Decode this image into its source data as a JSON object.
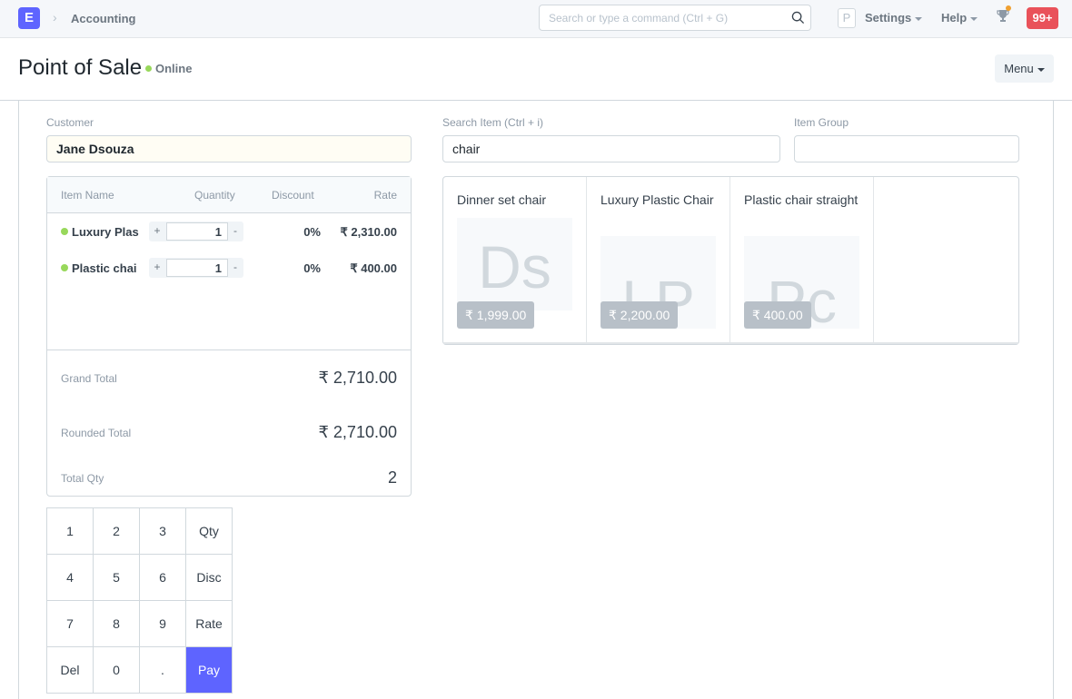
{
  "navbar": {
    "logo_letter": "E",
    "breadcrumb": "Accounting",
    "search_placeholder": "Search or type a command (Ctrl + G)",
    "search_value": "",
    "avatar_letter": "P",
    "settings_label": "Settings",
    "help_label": "Help",
    "notification_count": "99+"
  },
  "page": {
    "title": "Point of Sale",
    "status": "Online",
    "menu_label": "Menu"
  },
  "customer": {
    "label": "Customer",
    "value": "Jane Dsouza"
  },
  "cart": {
    "columns": [
      "Item Name",
      "Quantity",
      "Discount",
      "Rate"
    ],
    "rows": [
      {
        "name": "Luxury Plas",
        "qty": "1",
        "discount": "0%",
        "rate": "₹ 2,310.00"
      },
      {
        "name": "Plastic chai",
        "qty": "1",
        "discount": "0%",
        "rate": "₹ 400.00"
      }
    ],
    "plus_label": "+",
    "minus_label": "-",
    "grand_total_label": "Grand Total",
    "grand_total": "₹ 2,710.00",
    "rounded_total_label": "Rounded Total",
    "rounded_total": "₹ 2,710.00",
    "total_qty_label": "Total Qty",
    "total_qty": "2"
  },
  "numpad": {
    "keys": [
      "1",
      "2",
      "3",
      "Qty",
      "4",
      "5",
      "6",
      "Disc",
      "7",
      "8",
      "9",
      "Rate",
      "Del",
      "0",
      ".",
      "Pay"
    ]
  },
  "item_search": {
    "label": "Search Item (Ctrl + i)",
    "value": "chair",
    "group_label": "Item Group",
    "group_value": ""
  },
  "items": [
    {
      "title": "Dinner set chair",
      "initials": "Ds",
      "price": "₹ 1,999.00"
    },
    {
      "title": "Luxury Plastic Chair",
      "initials": "LP",
      "price": "₹ 2,200.00"
    },
    {
      "title": "Plastic chair straight",
      "initials": "Pc",
      "price": "₹ 400.00"
    }
  ],
  "colors": {
    "brand": "#5e64ff",
    "online": "#98d85b",
    "notification": "#e9525a"
  }
}
